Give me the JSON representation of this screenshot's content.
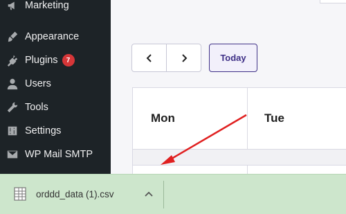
{
  "sidebar": {
    "items": [
      {
        "label": "Marketing",
        "icon": "megaphone-icon"
      },
      {
        "label": "Appearance",
        "icon": "paintbrush-icon"
      },
      {
        "label": "Plugins",
        "icon": "plugin-icon",
        "badge": "7"
      },
      {
        "label": "Users",
        "icon": "user-icon"
      },
      {
        "label": "Tools",
        "icon": "wrench-icon"
      },
      {
        "label": "Settings",
        "icon": "sliders-icon"
      },
      {
        "label": "WP Mail SMTP",
        "icon": "envelope-icon"
      }
    ]
  },
  "calendar": {
    "prev_label": "‹",
    "next_label": "›",
    "today_label": "Today",
    "days": [
      "Mon",
      "Tue"
    ]
  },
  "download": {
    "file_name": "orddd_data (1).csv",
    "file_icon": "spreadsheet-icon",
    "chevron_icon": "chevron-up-icon"
  },
  "annotation": {
    "arrow_color": "#e02020"
  }
}
